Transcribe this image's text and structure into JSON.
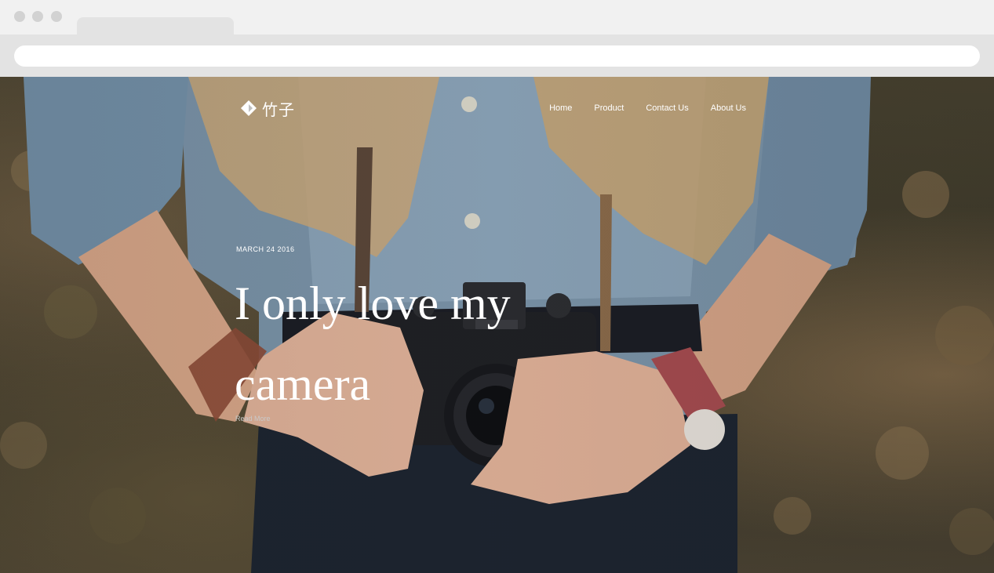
{
  "site": {
    "logo_text": "竹子",
    "nav": [
      "Home",
      "Product",
      "Contact Us",
      "About Us"
    ]
  },
  "post": {
    "date": "MARCH 24 2016",
    "title": "I only love my camera",
    "read_more": "Read More"
  },
  "icons": {
    "logo": "diamond-logo-icon",
    "window_controls": [
      "window-dot-icon",
      "window-dot-icon",
      "window-dot-icon"
    ]
  },
  "colors": {
    "chrome_top": "#f1f1f1",
    "chrome_bar": "#e3e3e3",
    "text_on_photo": "#ffffff"
  }
}
